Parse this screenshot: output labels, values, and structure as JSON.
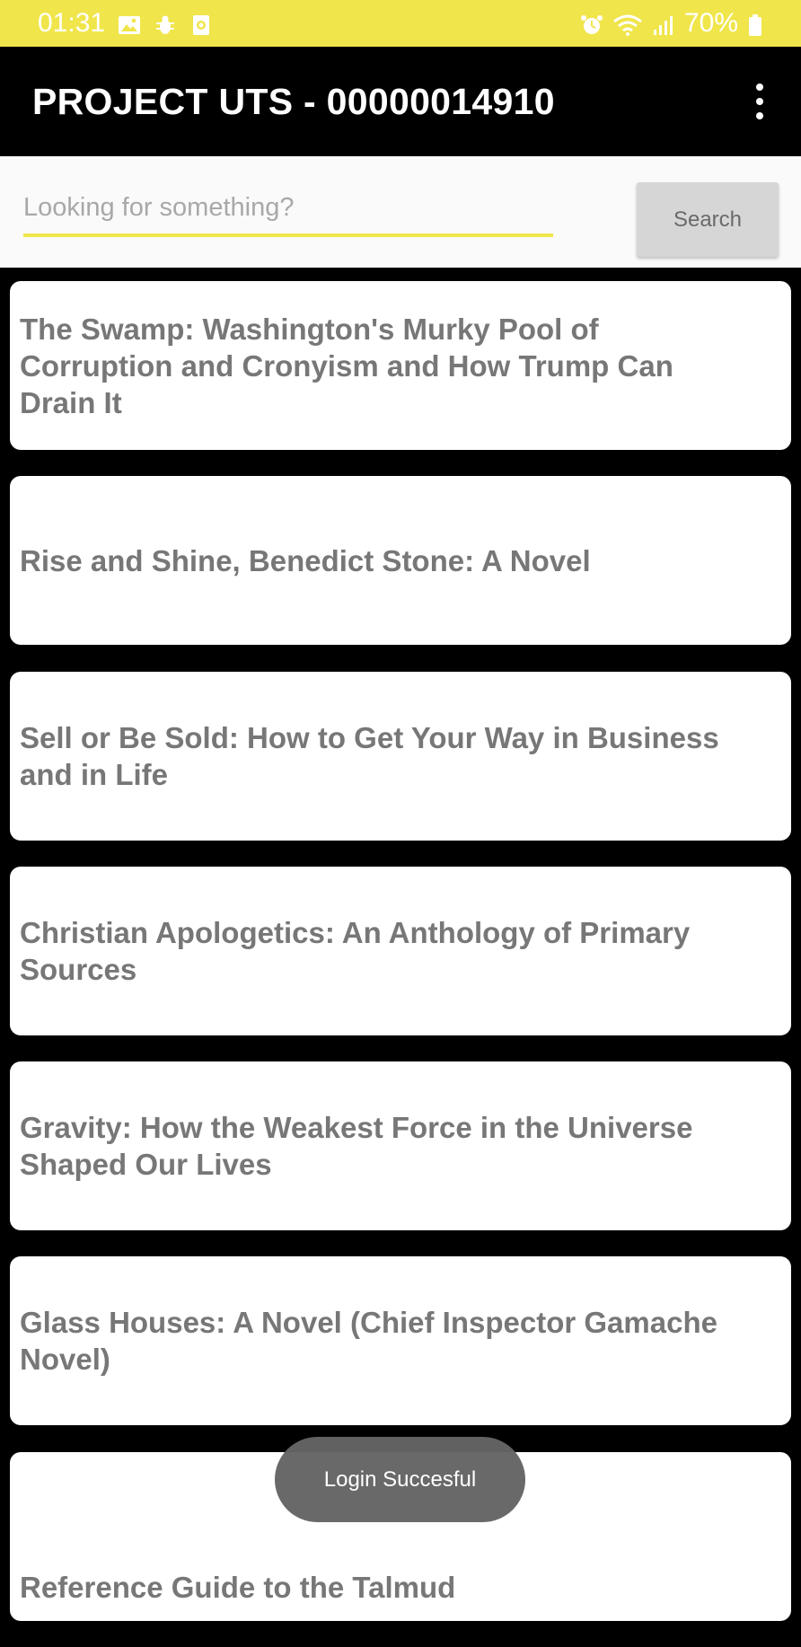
{
  "status_bar": {
    "time": "01:31",
    "battery": "70%",
    "background_color": "#f0e54a",
    "left_icons": [
      "image-icon",
      "bug-icon",
      "camera-icon"
    ],
    "right_icons": [
      "alarm-icon",
      "wifi-icon",
      "signal-icon",
      "battery-icon"
    ]
  },
  "app_bar": {
    "title": "PROJECT UTS - 00000014910",
    "menu_icon": "more-vert-icon"
  },
  "search": {
    "placeholder": "Looking for something?",
    "value": "",
    "button_label": "Search",
    "accent_color": "#f0e54a"
  },
  "books": [
    {
      "title": "The Swamp: Washington's Murky Pool of Corruption and Cronyism and How Trump Can Drain It"
    },
    {
      "title": "Rise and Shine, Benedict Stone: A Novel"
    },
    {
      "title": "Sell or Be Sold: How to Get Your Way in Business and in Life"
    },
    {
      "title": "Christian Apologetics: An Anthology of Primary Sources"
    },
    {
      "title": "Gravity: How the Weakest Force in the Universe Shaped Our Lives"
    },
    {
      "title": "Glass Houses: A Novel (Chief Inspector Gamache Novel)"
    },
    {
      "title": "Reference Guide to the Talmud"
    }
  ],
  "toast": {
    "message": "Login Succesful"
  }
}
